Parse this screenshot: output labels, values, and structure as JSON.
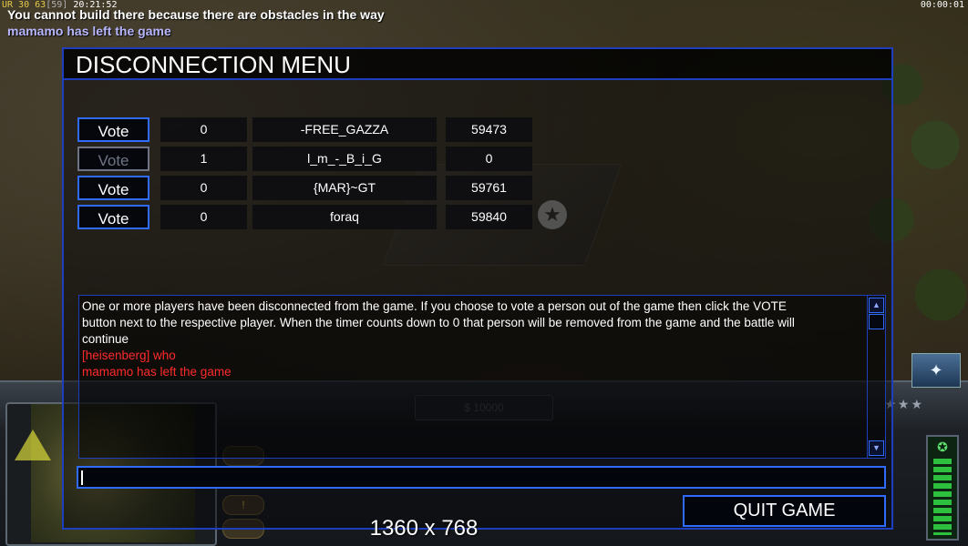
{
  "hud": {
    "top_stat_a": "UR 30",
    "top_stat_b": "63",
    "top_stat_c": "[59]",
    "top_time": "20:21:52",
    "game_clock": "00:00:01",
    "message_1": "You cannot build there because there are obstacles in the way",
    "message_2": "mamamo has left the game",
    "money": "$ 10000"
  },
  "dialog": {
    "title": "DISCONNECTION MENU",
    "vote_label": "Vote",
    "players": [
      {
        "votes": "0",
        "name": "-FREE_GAZZA",
        "ping": "59473",
        "vote_enabled": true
      },
      {
        "votes": "1",
        "name": "l_m_-_B_i_G",
        "ping": "0",
        "vote_enabled": false
      },
      {
        "votes": "0",
        "name": "{MAR}~GT",
        "ping": "59761",
        "vote_enabled": true
      },
      {
        "votes": "0",
        "name": "foraq",
        "ping": "59840",
        "vote_enabled": true
      }
    ],
    "chat_lines": [
      {
        "text": "One or more players have been disconnected from the game. If you choose to vote a person out of the game then click the VOTE",
        "color": "#ffffff"
      },
      {
        "text": " button next to the respective player. When the timer counts down to 0 that person will be removed from the game and the battle will",
        "color": "#ffffff"
      },
      {
        "text": " continue",
        "color": "#ffffff"
      },
      {
        "text": "[heisenberg] who",
        "color": "#ff2a2a"
      },
      {
        "text": "mamamo has left the game",
        "color": "#ff2a2a"
      }
    ],
    "chat_input_value": "",
    "quit_label": "QUIT GAME",
    "resolution_text": "1360 x 768"
  },
  "colors": {
    "dialog_border": "#1e3ec0",
    "button_border": "#2f6bff",
    "chat_red": "#ff2a2a",
    "system_message": "#b7b7ff"
  }
}
